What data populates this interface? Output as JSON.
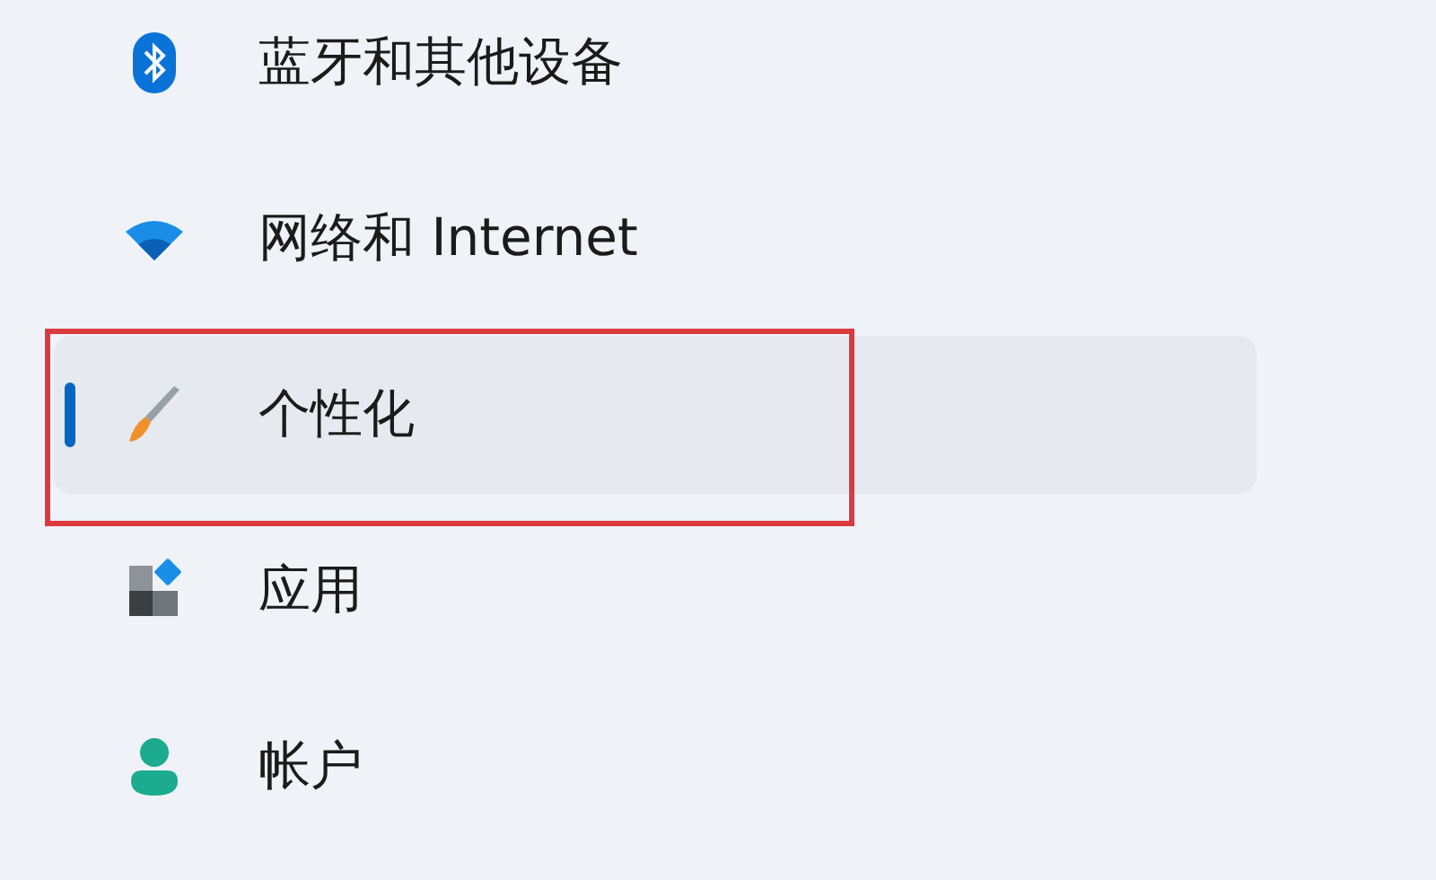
{
  "nav_items": [
    {
      "label": "蓝牙和其他设备",
      "kind": "bluetooth",
      "selected": false,
      "highlighted": false
    },
    {
      "label": "网络和 Internet",
      "kind": "wifi",
      "selected": false,
      "highlighted": false
    },
    {
      "label": "个性化",
      "kind": "brush",
      "selected": true,
      "highlighted": true
    },
    {
      "label": "应用",
      "kind": "apps",
      "selected": false,
      "highlighted": false
    },
    {
      "label": "帐户",
      "kind": "account",
      "selected": false,
      "highlighted": false
    }
  ]
}
